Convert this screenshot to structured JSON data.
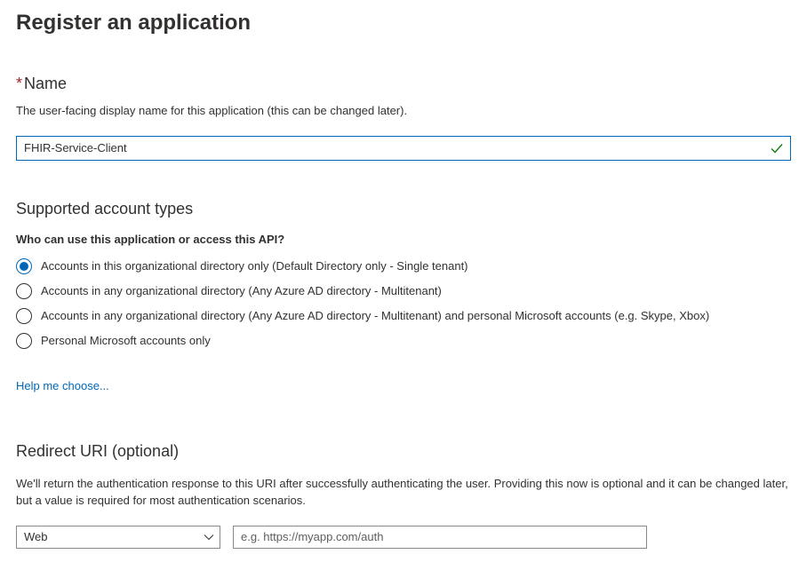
{
  "page": {
    "title": "Register an application"
  },
  "nameField": {
    "label": "Name",
    "required_mark": "*",
    "description": "The user-facing display name for this application (this can be changed later).",
    "value": "FHIR-Service-Client"
  },
  "accountTypes": {
    "heading": "Supported account types",
    "question": "Who can use this application or access this API?",
    "options": [
      {
        "label": "Accounts in this organizational directory only (Default Directory only - Single tenant)",
        "selected": true
      },
      {
        "label": "Accounts in any organizational directory (Any Azure AD directory - Multitenant)",
        "selected": false
      },
      {
        "label": "Accounts in any organizational directory (Any Azure AD directory - Multitenant) and personal Microsoft accounts (e.g. Skype, Xbox)",
        "selected": false
      },
      {
        "label": "Personal Microsoft accounts only",
        "selected": false
      }
    ],
    "helpLink": "Help me choose..."
  },
  "redirectUri": {
    "heading": "Redirect URI (optional)",
    "description": "We'll return the authentication response to this URI after successfully authenticating the user. Providing this now is optional and it can be changed later, but a value is required for most authentication scenarios.",
    "platform_selected": "Web",
    "uri_placeholder": "e.g. https://myapp.com/auth",
    "uri_value": ""
  }
}
